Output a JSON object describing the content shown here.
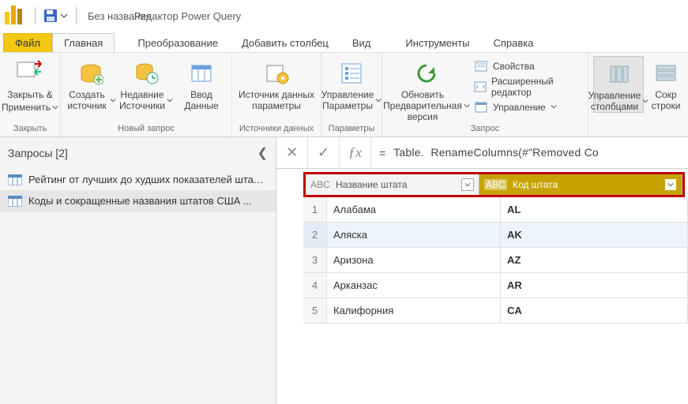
{
  "titlebar": {
    "doc_title": "Без названия",
    "editor_title": "Редактор Power Query"
  },
  "tabs": {
    "file": "Файл",
    "home": "Главная",
    "transform": "Преобразование",
    "addcol": "Добавить столбец",
    "view": "Вид",
    "tools": "Инструменты",
    "help": "Справка"
  },
  "ribbon": {
    "close": {
      "label1": "Закрыть &",
      "label2": "Применить",
      "group": "Закрыть"
    },
    "newquery": {
      "new_source": "Создать источник",
      "recent": "Недавние Источники",
      "enter_data": "Ввод Данные",
      "group": "Новый запрос"
    },
    "params": {
      "btn": "Источник данных параметры",
      "group": "Источники данных"
    },
    "manage": {
      "btn": "Управление Параметры",
      "group": "Параметры"
    },
    "refresh": {
      "btn": "Обновить Предварительная версия",
      "props": "Свойства",
      "adv": "Расширенный редактор",
      "mng": "Управление",
      "group": "Запрос"
    },
    "cols": {
      "btn1": "Управление столбцами",
      "btn2": "Сокр строки"
    }
  },
  "queries": {
    "header": "Запросы [2]",
    "items": [
      "Рейтинг от лучших до худших показателей штатов",
      "Коды и сокращенные названия штатов США ..."
    ]
  },
  "formula": {
    "prefix": "=",
    "ns": "Table.",
    "fn": "RenameColumns(#\"Removed Co"
  },
  "columns": {
    "c1_prefix": "ABC",
    "c1_label": "Название штата",
    "c2_prefix": "ABC",
    "c2_label": "Код штата"
  },
  "rows": [
    {
      "n": "1",
      "name": "Алабама",
      "code": "AL"
    },
    {
      "n": "2",
      "name": "Аляска",
      "code": "AK"
    },
    {
      "n": "3",
      "name": "Аризона",
      "code": "AZ"
    },
    {
      "n": "4",
      "name": "Арканзас",
      "code": "AR"
    },
    {
      "n": "5",
      "name": "Калифорния",
      "code": "CA"
    }
  ]
}
